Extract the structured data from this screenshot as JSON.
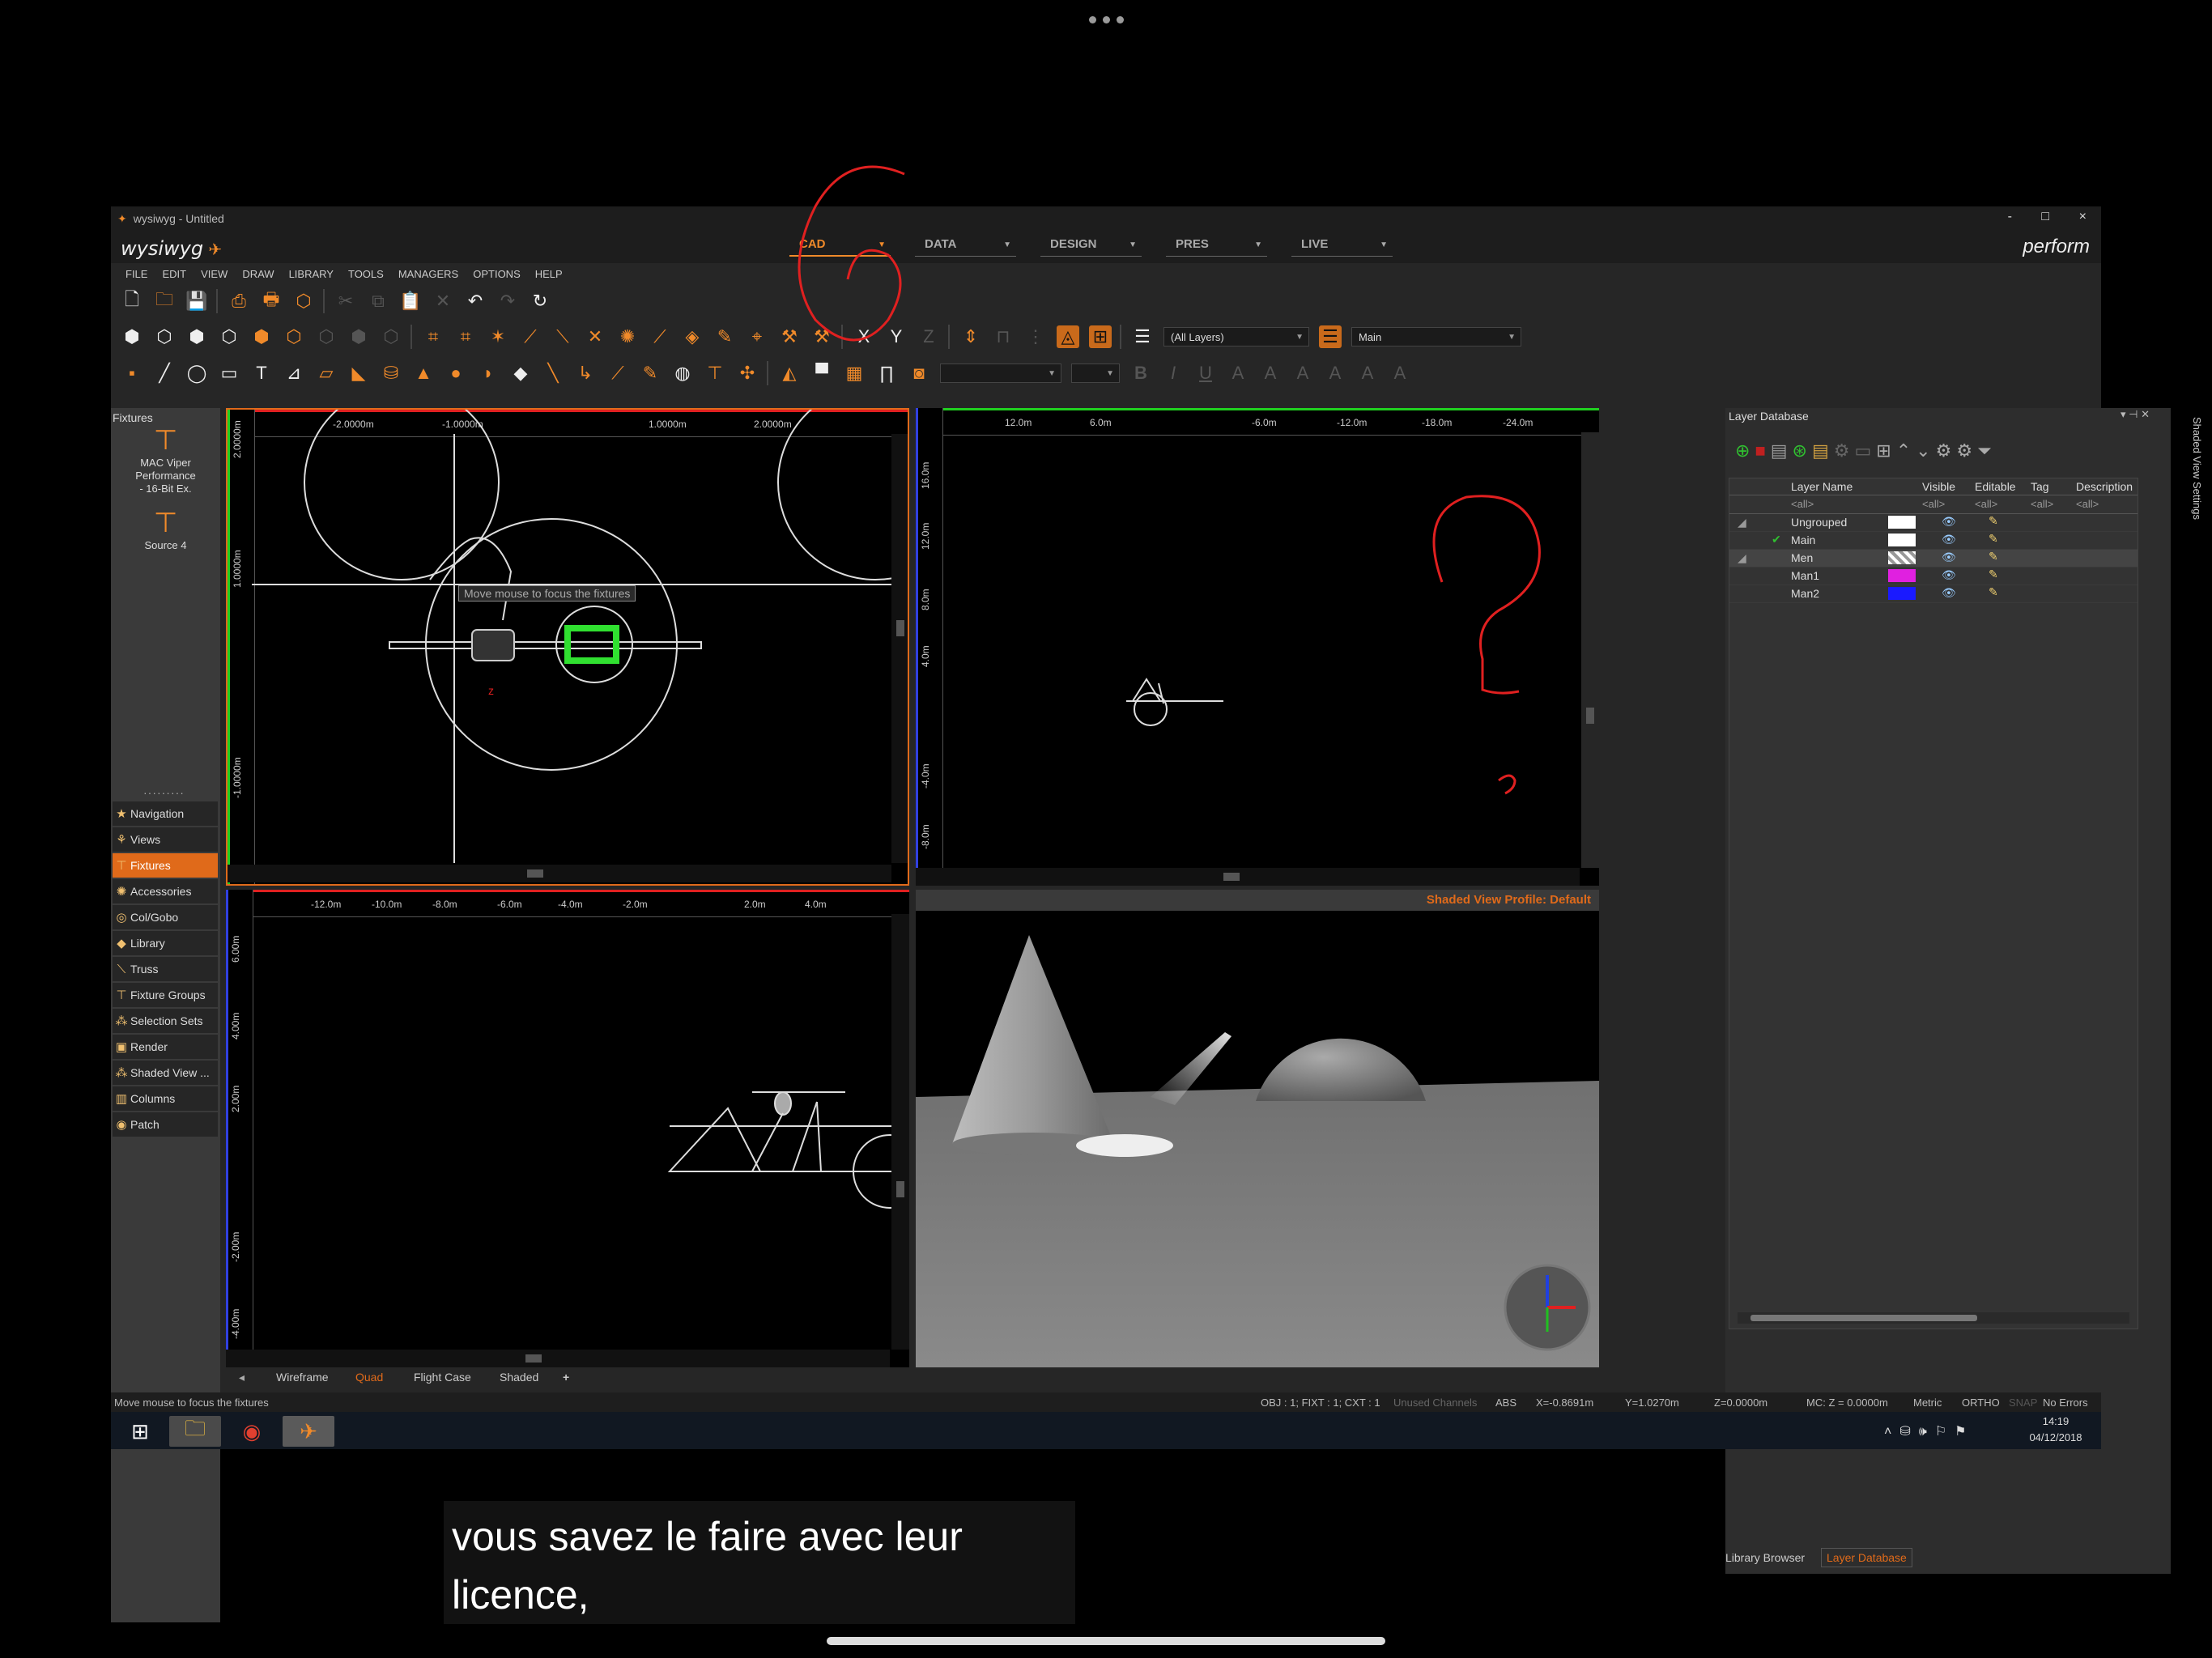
{
  "window": {
    "title": "wysiwyg - Untitled",
    "brand": "wysiwyg",
    "mode_label": "perform",
    "controls": [
      "-",
      "□",
      "×"
    ]
  },
  "modes": [
    {
      "label": "CAD",
      "active": true
    },
    {
      "label": "DATA",
      "active": false
    },
    {
      "label": "DESIGN",
      "active": false
    },
    {
      "label": "PRES",
      "active": false
    },
    {
      "label": "LIVE",
      "active": false
    }
  ],
  "menu": [
    "FILE",
    "EDIT",
    "VIEW",
    "DRAW",
    "LIBRARY",
    "TOOLS",
    "MANAGERS",
    "OPTIONS",
    "HELP"
  ],
  "toolbar": {
    "axes": [
      "X",
      "Y",
      "Z"
    ],
    "layer_filter": "(All Layers)",
    "active_layer": "Main",
    "text_format": [
      "B",
      "I",
      "U"
    ]
  },
  "fixtures_panel": {
    "title": "Fixtures",
    "items": [
      {
        "name": "MAC Viper Performance - 16-Bit Ex."
      },
      {
        "name": "Source 4"
      }
    ]
  },
  "nav": {
    "grip": "·········",
    "items": [
      {
        "label": "Navigation",
        "icon": "star-icon"
      },
      {
        "label": "Views",
        "icon": "views-icon"
      },
      {
        "label": "Fixtures",
        "icon": "fixture-icon",
        "active": true
      },
      {
        "label": "Accessories",
        "icon": "accessory-icon"
      },
      {
        "label": "Col/Gobo",
        "icon": "gobo-icon"
      },
      {
        "label": "Library",
        "icon": "library-icon"
      },
      {
        "label": "Truss",
        "icon": "truss-icon"
      },
      {
        "label": "Fixture Groups",
        "icon": "groups-icon"
      },
      {
        "label": "Selection Sets",
        "icon": "selection-icon"
      },
      {
        "label": "Render",
        "icon": "render-icon"
      },
      {
        "label": "Shaded View ...",
        "icon": "shaded-icon"
      },
      {
        "label": "Columns",
        "icon": "columns-icon"
      },
      {
        "label": "Patch",
        "icon": "patch-icon"
      }
    ]
  },
  "viewport_top": {
    "ruler_h": [
      "-2.0000m",
      "-1.0000m",
      "1.0000m",
      "2.0000m"
    ],
    "ruler_v": [
      "2.0000m",
      "1.0000m",
      "-1.0000m"
    ],
    "tooltip": "Move mouse to focus the fixtures"
  },
  "viewport_front": {
    "ruler_h": [
      "12.0m",
      "6.0m",
      "-6.0m",
      "-12.0m",
      "-18.0m",
      "-24.0m"
    ],
    "ruler_v": [
      "16.0m",
      "12.0m",
      "8.0m",
      "4.0m",
      "-4.0m",
      "-8.0m"
    ]
  },
  "viewport_side": {
    "ruler_h": [
      "-12.0m",
      "-10.0m",
      "-8.0m",
      "-6.0m",
      "-4.0m",
      "-2.0m",
      "2.0m",
      "4.0m"
    ],
    "ruler_v": [
      "6.00m",
      "4.00m",
      "2.00m",
      "-2.00m",
      "-4.00m"
    ]
  },
  "viewport_shaded": {
    "profile": "Shaded View Profile: Default"
  },
  "layer_db": {
    "title": "Layer Database",
    "side_tab": "Shaded View Settings",
    "columns": [
      "Layer Name",
      "Visible",
      "Editable",
      "Tag",
      "Description"
    ],
    "filters": [
      "<all>",
      "<all>",
      "<all>",
      "<all>",
      "<all>"
    ],
    "rows": [
      {
        "name": "Ungrouped",
        "color": "#ffffff"
      },
      {
        "name": "Main",
        "color": "#ffffff",
        "current": true
      },
      {
        "name": "Men",
        "color": "checker"
      },
      {
        "name": "Man1",
        "color": "#e020e0"
      },
      {
        "name": "Man2",
        "color": "#1a1aff"
      }
    ],
    "tabs": [
      "Library Browser",
      "Layer Database"
    ]
  },
  "view_tabs": [
    "Wireframe",
    "Quad",
    "Flight Case",
    "Shaded",
    "+"
  ],
  "status": {
    "message": "Move mouse to focus the fixtures",
    "counts": "OBJ : 1; FIXT : 1; CXT : 1",
    "unused": "Unused Channels",
    "abs": "ABS",
    "x": "X=-0.8691m",
    "y": "Y=1.0270m",
    "z": "Z=0.0000m",
    "mc": "MC: Z = 0.0000m",
    "units": "Metric",
    "ortho": "ORTHO",
    "snap": "SNAP",
    "errors": "No Errors"
  },
  "taskbar": {
    "time": "14:19",
    "date": "04/12/2018"
  },
  "subtitle": {
    "line1": "vous savez le faire avec leur",
    "line2": "licence,"
  }
}
